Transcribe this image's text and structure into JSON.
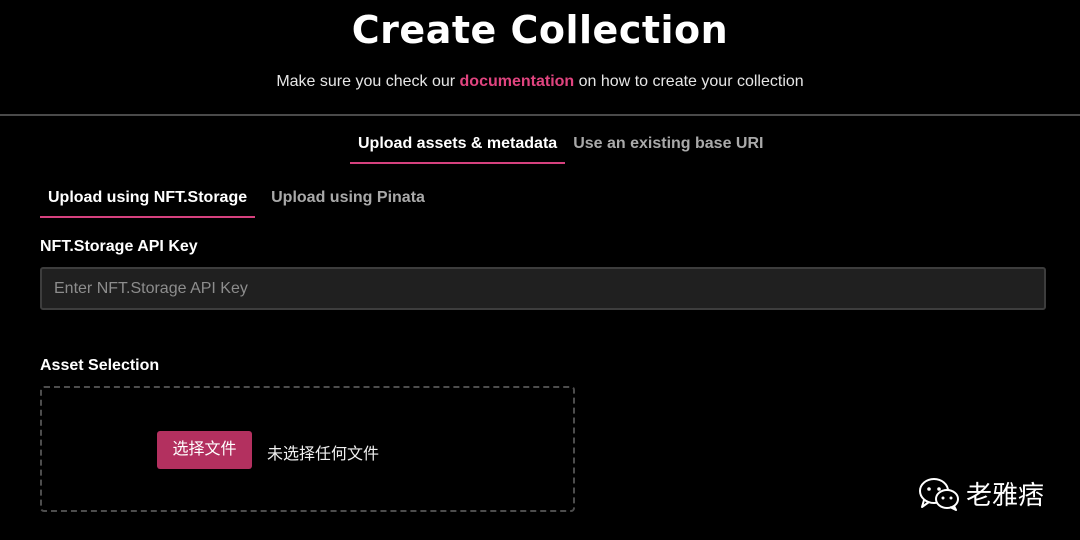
{
  "page": {
    "title": "Create Collection",
    "subtitle_before": "Make sure you check our ",
    "subtitle_link": "documentation",
    "subtitle_after": " on how to create your collection"
  },
  "main_tabs": [
    {
      "label": "Upload assets & metadata",
      "active": true
    },
    {
      "label": "Use an existing base URI",
      "active": false
    }
  ],
  "sub_tabs": [
    {
      "label": "Upload using NFT.Storage",
      "active": true
    },
    {
      "label": "Upload using Pinata",
      "active": false
    }
  ],
  "api_key": {
    "label": "NFT.Storage API Key",
    "value": "",
    "placeholder": "Enter NFT.Storage API Key"
  },
  "asset_selection": {
    "label": "Asset Selection",
    "button_label": "选择文件",
    "status_text": "未选择任何文件"
  },
  "watermark": {
    "text": "老雅痞",
    "icon": "wechat-icon"
  },
  "colors": {
    "background": "#000000",
    "accent": "#d6417e",
    "button": "#b3305f",
    "input_bg": "#202020"
  }
}
